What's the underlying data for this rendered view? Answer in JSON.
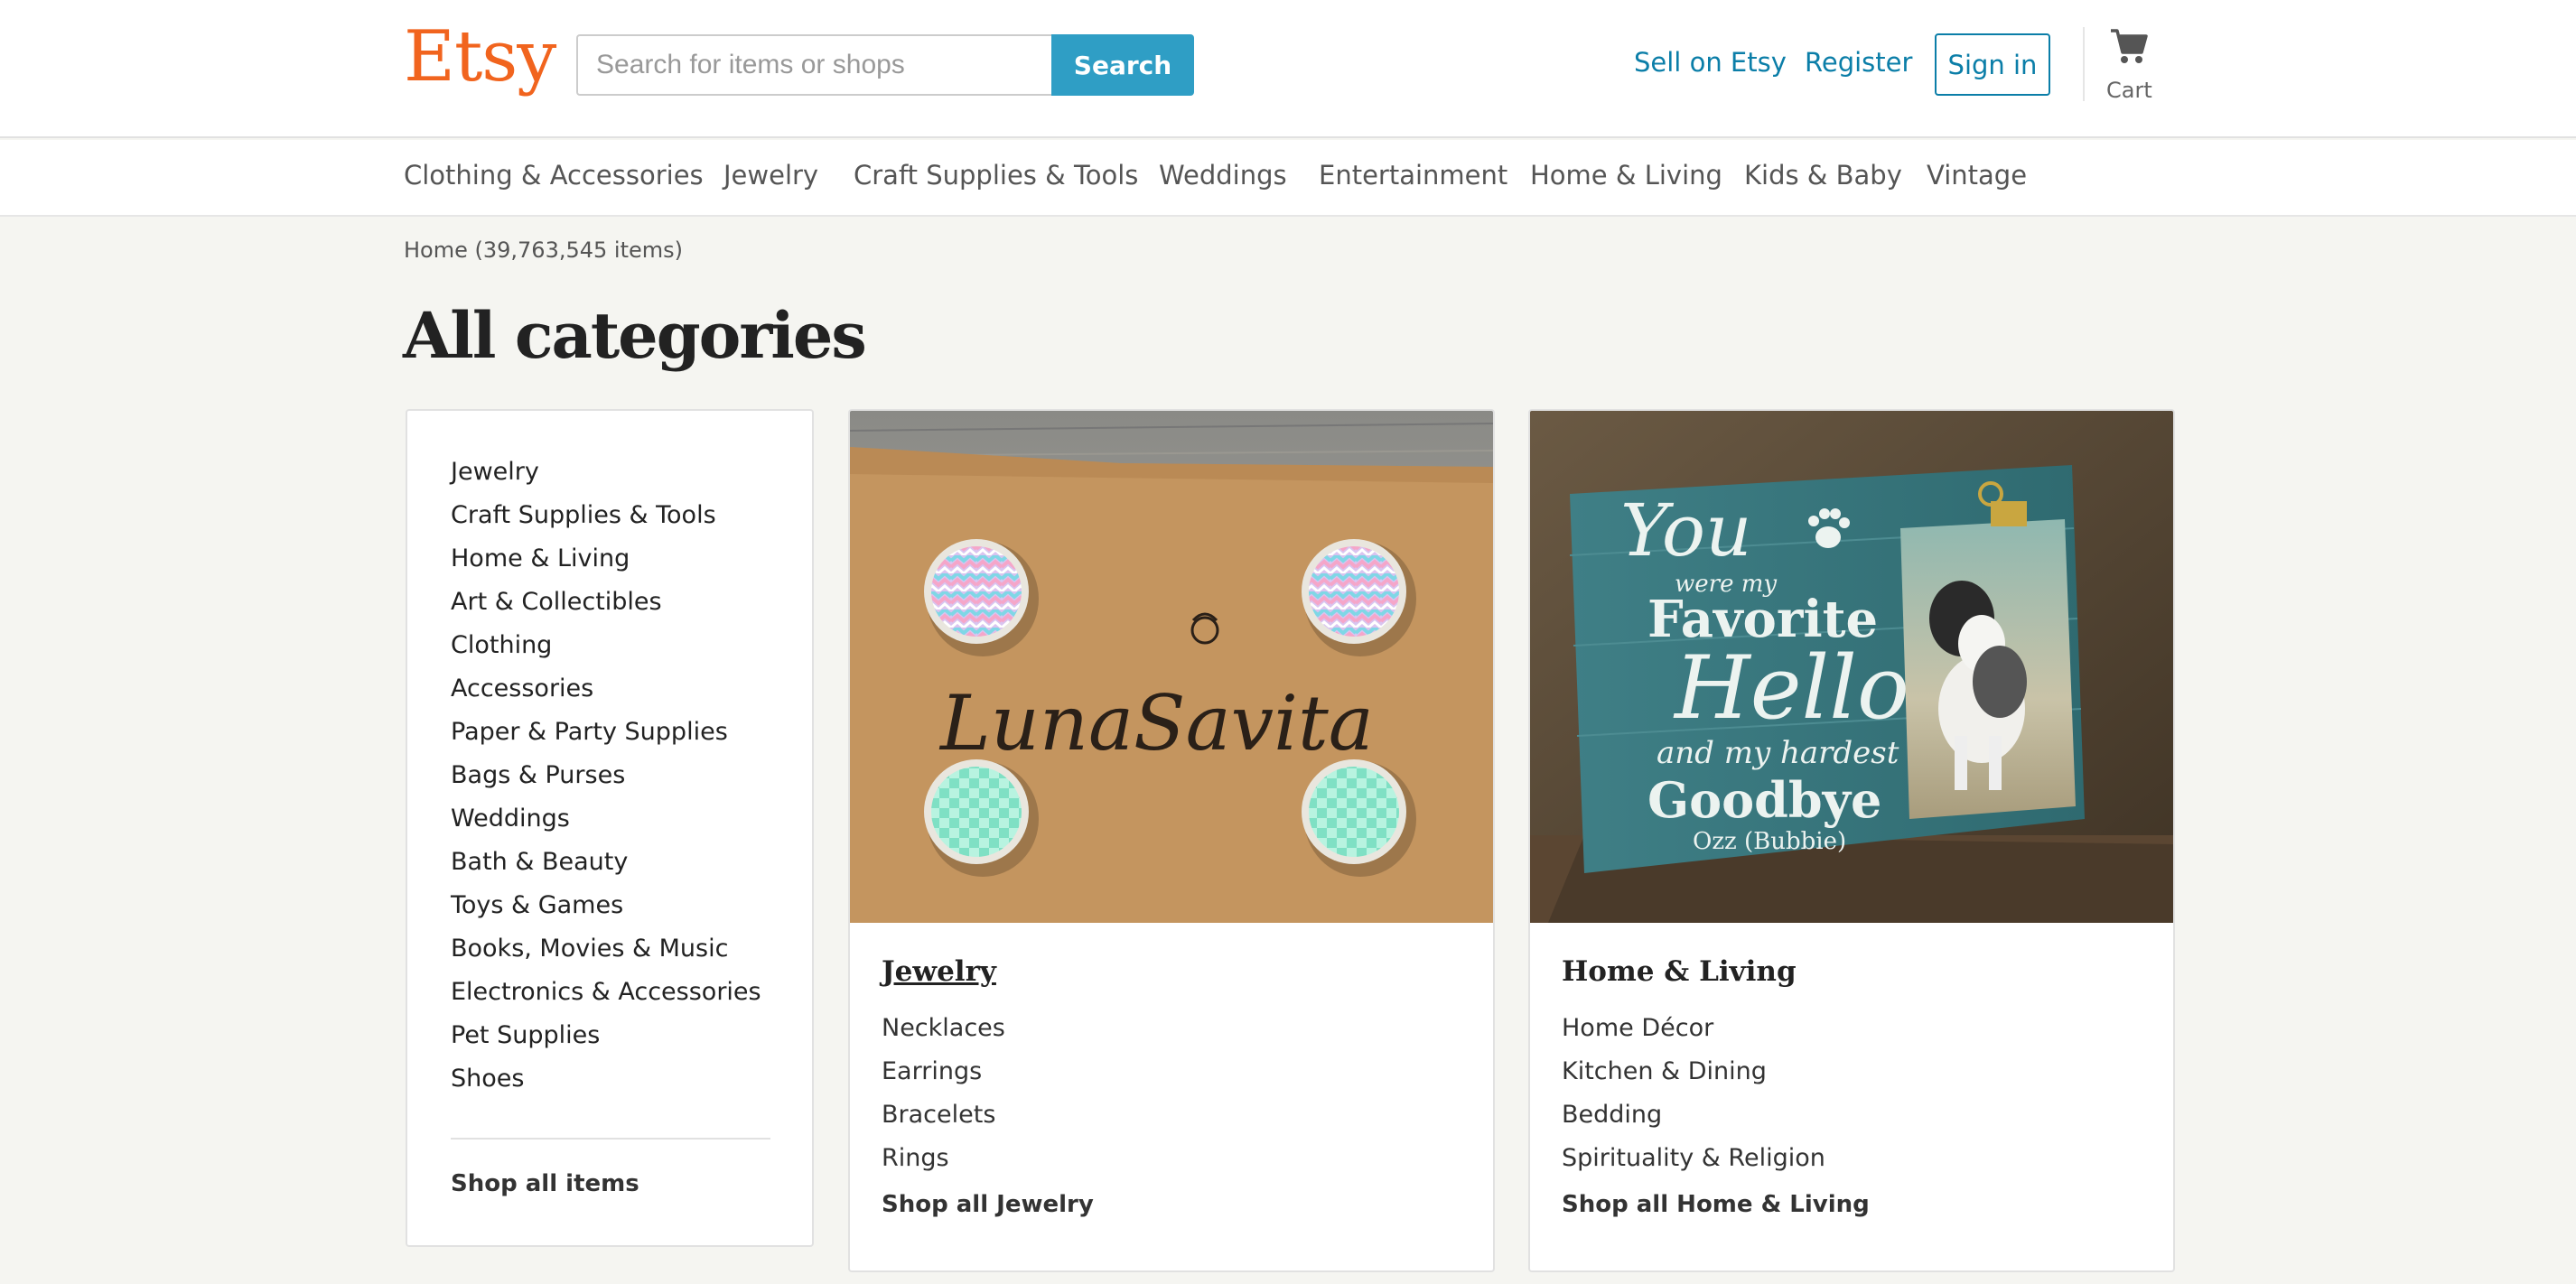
{
  "header": {
    "logo": "Etsy",
    "search_placeholder": "Search for items or shops",
    "search_button": "Search",
    "sell_link": "Sell on Etsy",
    "register_link": "Register",
    "signin_button": "Sign in",
    "cart_label": "Cart"
  },
  "nav": {
    "items": [
      "Clothing & Accessories",
      "Jewelry",
      "Craft Supplies & Tools",
      "Weddings",
      "Entertainment",
      "Home & Living",
      "Kids & Baby",
      "Vintage"
    ]
  },
  "breadcrumb": "Home (39,763,545 items)",
  "page_title": "All categories",
  "sidebar": {
    "items": [
      "Jewelry",
      "Craft Supplies & Tools",
      "Home & Living",
      "Art & Collectibles",
      "Clothing",
      "Accessories",
      "Paper & Party Supplies",
      "Bags & Purses",
      "Weddings",
      "Bath & Beauty",
      "Toys & Games",
      "Books, Movies & Music",
      "Electronics & Accessories",
      "Pet Supplies",
      "Shoes"
    ],
    "shop_all": "Shop all items"
  },
  "cards": [
    {
      "title": "Jewelry",
      "items": [
        "Necklaces",
        "Earrings",
        "Bracelets",
        "Rings"
      ],
      "shop_all": "Shop all Jewelry",
      "image_text": "LunaSavita"
    },
    {
      "title": "Home & Living",
      "items": [
        "Home Décor",
        "Kitchen & Dining",
        "Bedding",
        "Spirituality & Religion"
      ],
      "shop_all": "Shop all Home & Living",
      "image_text": {
        "line1": "You",
        "line2": "were my",
        "line3": "Favorite",
        "line4": "Hello",
        "line5": "and my hardest",
        "line6": "Goodbye",
        "line7": "Ozz (Bubbie)"
      }
    }
  ],
  "colors": {
    "brand": "#f1641e",
    "link": "#0b7ea8",
    "search_button": "#2f9ec5",
    "page_bg": "#f5f5f1"
  },
  "icons": {
    "cart": "cart-icon",
    "paw": "paw-icon"
  }
}
